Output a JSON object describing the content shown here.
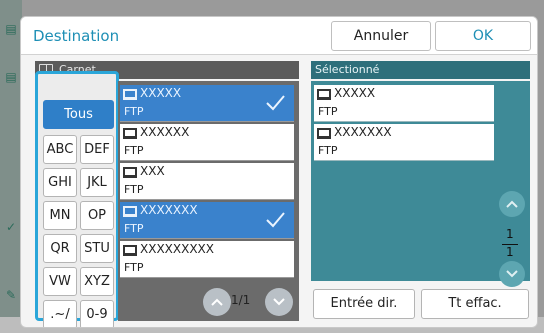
{
  "dialog": {
    "title": "Destination",
    "cancel_label": "Annuler",
    "ok_label": "OK"
  },
  "carnet": {
    "header": "Carnet",
    "letters": [
      "Tous",
      "ABC",
      "DEF",
      "GHI",
      "JKL",
      "MN",
      "OP",
      "QR",
      "STU",
      "VW",
      "XYZ",
      ".~/",
      "0-9"
    ],
    "selected_letter": "Tous",
    "items": [
      {
        "name": "XXXXX",
        "type": "FTP",
        "selected": true
      },
      {
        "name": "XXXXXX",
        "type": "FTP",
        "selected": false
      },
      {
        "name": "XXX",
        "type": "FTP",
        "selected": false
      },
      {
        "name": "XXXXXXX",
        "type": "FTP",
        "selected": true
      },
      {
        "name": "XXXXXXXXX",
        "type": "FTP",
        "selected": false
      }
    ],
    "page": "1/1"
  },
  "selected": {
    "header": "Sélectionné",
    "items": [
      {
        "name": "XXXXX",
        "type": "FTP"
      },
      {
        "name": "XXXXXXX",
        "type": "FTP"
      }
    ],
    "page_current": "1",
    "page_total": "1"
  },
  "actions": {
    "direct_entry_label": "Entrée dir.",
    "clear_all_label": "Tt effac."
  },
  "colors": {
    "accent": "#1e8fb5",
    "selected_row": "#3a82cc",
    "selected_panel": "#3e8a97",
    "letter_frame": "#2aa6d9"
  }
}
